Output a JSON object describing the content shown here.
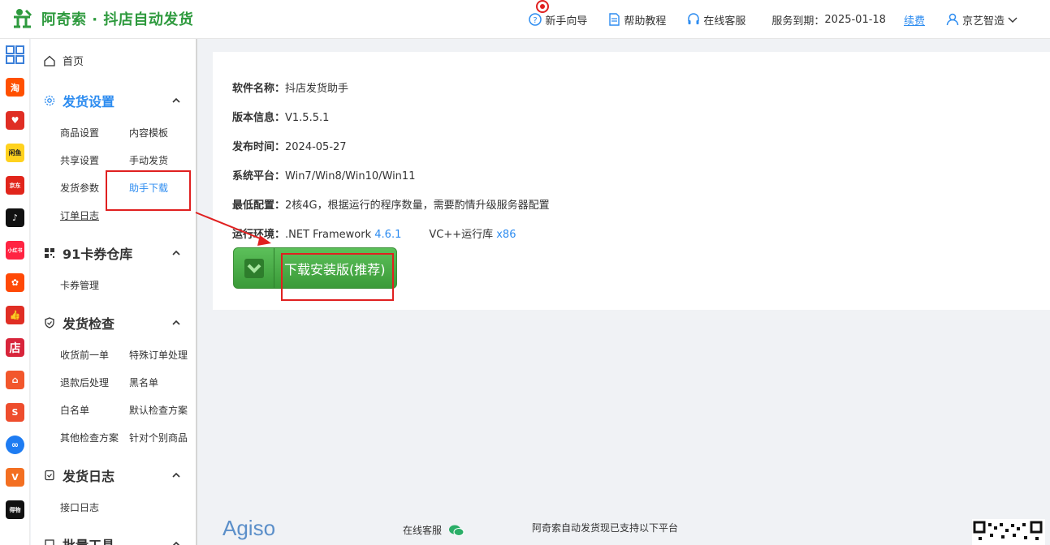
{
  "header": {
    "brand": "阿奇索 · 抖店自动发货",
    "guide": "新手向导",
    "help": "帮助教程",
    "service": "在线客服",
    "expiry_label": "服务到期：",
    "expiry_date": "2025-01-18",
    "renew": "续费",
    "user": "京艺智造"
  },
  "platforms": [
    "qianniu-icon",
    "taobao-icon",
    "pinduoduo-icon",
    "youzan-icon",
    "jd-icon",
    "douyin-icon",
    "xiaohongshu-icon",
    "kuaishou-icon",
    "dianshang-icon",
    "weidian-icon",
    "alibaba-icon",
    "shopee-icon",
    "link-icon",
    "vip-icon",
    "dewu-icon"
  ],
  "sidebar": {
    "home": "首页",
    "sections": [
      {
        "title": "发货设置",
        "items": [
          "商品设置",
          "内容模板",
          "共享设置",
          "手动发货",
          "发货参数",
          "助手下载",
          "订单日志"
        ]
      },
      {
        "title": "91卡券仓库",
        "items": [
          "卡券管理"
        ]
      },
      {
        "title": "发货检查",
        "items": [
          "收货前一单",
          "特殊订单处理",
          "退款后处理",
          "黑名单",
          "白名单",
          "默认检查方案",
          "其他检查方案",
          "针对个别商品"
        ]
      },
      {
        "title": "发货日志",
        "items": [
          "接口日志"
        ]
      },
      {
        "title": "批量工具",
        "items": []
      }
    ]
  },
  "info": {
    "name_k": "软件名称：",
    "name_v": "抖店发货助手",
    "ver_k": "版本信息：",
    "ver_v": "V1.5.5.1",
    "date_k": "发布时间：",
    "date_v": "2024-05-27",
    "sys_k": "系统平台：",
    "sys_v": "Win7/Win8/Win10/Win11",
    "cfg_k": "最低配置：",
    "cfg_v": "2核4G，根据运行的程序数量，需要酌情升级服务器配置",
    "env_k": "运行环境：",
    "env_v1": ".NET Framework ",
    "env_link1": "4.6.1",
    "env_v2": "VC++运行库 ",
    "env_link2": "x86",
    "download": "下载安装版(推荐)"
  },
  "footer": {
    "logo": "Agiso",
    "cs": "在线客服",
    "note": "阿奇索自动发货现已支持以下平台"
  },
  "colors": {
    "brand": "#2e9a3e",
    "accent": "#2d8cf0",
    "button": "#4caf50",
    "annotation": "#e02020"
  }
}
